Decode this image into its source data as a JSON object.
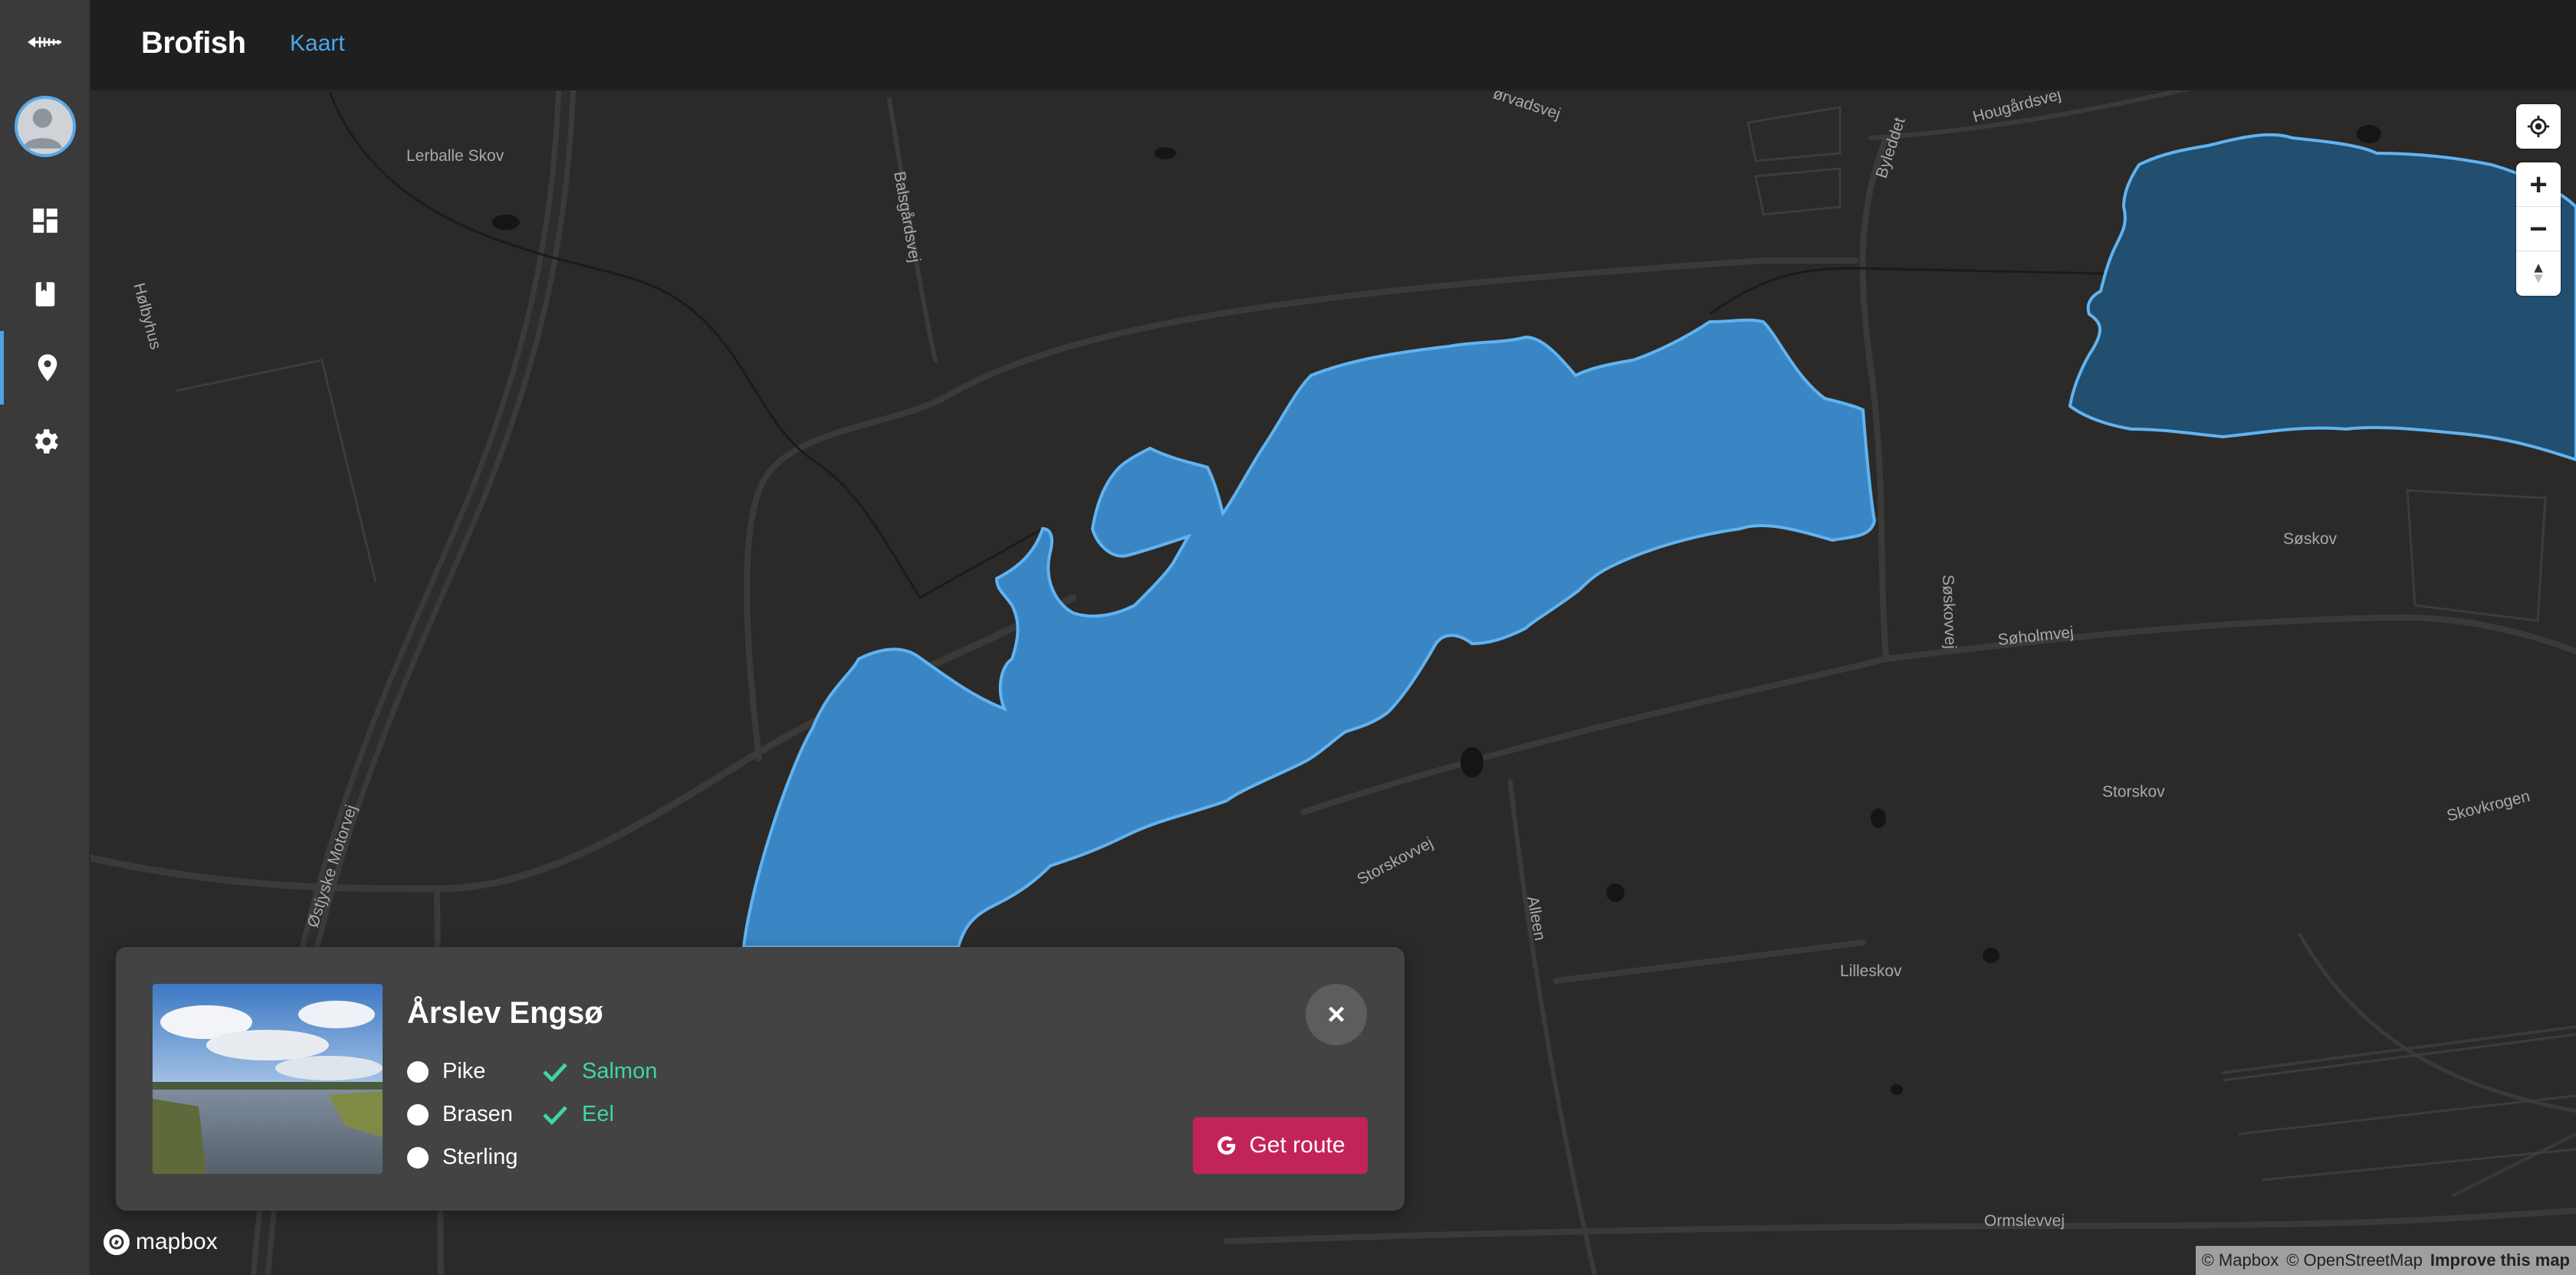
{
  "app": {
    "brand": "Brofish",
    "nav_tab": "Kaart"
  },
  "sidebar": {
    "logo_icon": "fish-skeleton-icon",
    "items": [
      {
        "name": "dashboard",
        "icon": "dashboard-icon"
      },
      {
        "name": "logbook",
        "icon": "book-icon"
      },
      {
        "name": "map",
        "icon": "map-pin-icon",
        "active": true
      },
      {
        "name": "settings",
        "icon": "gear-icon"
      }
    ]
  },
  "map": {
    "labels": {
      "lerballe_skov": "Lerballe Skov",
      "holbyhus": "Hølbyhus",
      "balsgardsvej": "Balsgårdsvej",
      "orvadsvej": "ørvadsvej",
      "byleddet": "Byleddet",
      "hougardsvej": "Hougårdsvej",
      "soskov": "Søskov",
      "soskovvej": "Søskovvej",
      "soholmvej": "Søholmvej",
      "storskov": "Storskov",
      "skovkrogen": "Skovkrogen",
      "storskovvej": "Storskovvej",
      "alleen": "Alleen",
      "lilleskov": "Lilleskov",
      "ormslevvej": "Ormslevvej",
      "motorvej": "Østjyske Motorvej"
    },
    "controls": {
      "locate_icon": "locate-icon",
      "zoom_in": "+",
      "zoom_out": "−",
      "compass_icon": "compass-icon"
    },
    "attribution": {
      "mapbox": "© Mapbox",
      "osm": "© OpenStreetMap",
      "improve": "Improve this map"
    },
    "logo_text": "mapbox",
    "colors": {
      "lake_selected": "#3a86c4",
      "lake_other": "#224e70",
      "lake_outline": "#62b3ef",
      "land": "#2b2a29"
    }
  },
  "popup": {
    "title": "Årslev Engsø",
    "fish": [
      {
        "name": "Pike",
        "caught": false
      },
      {
        "name": "Brasen",
        "caught": false
      },
      {
        "name": "Sterling",
        "caught": false
      },
      {
        "name": "Salmon",
        "caught": true
      },
      {
        "name": "Eel",
        "caught": true
      }
    ],
    "close_label": "×",
    "route_label": "Get route",
    "route_icon": "google-g-icon"
  }
}
